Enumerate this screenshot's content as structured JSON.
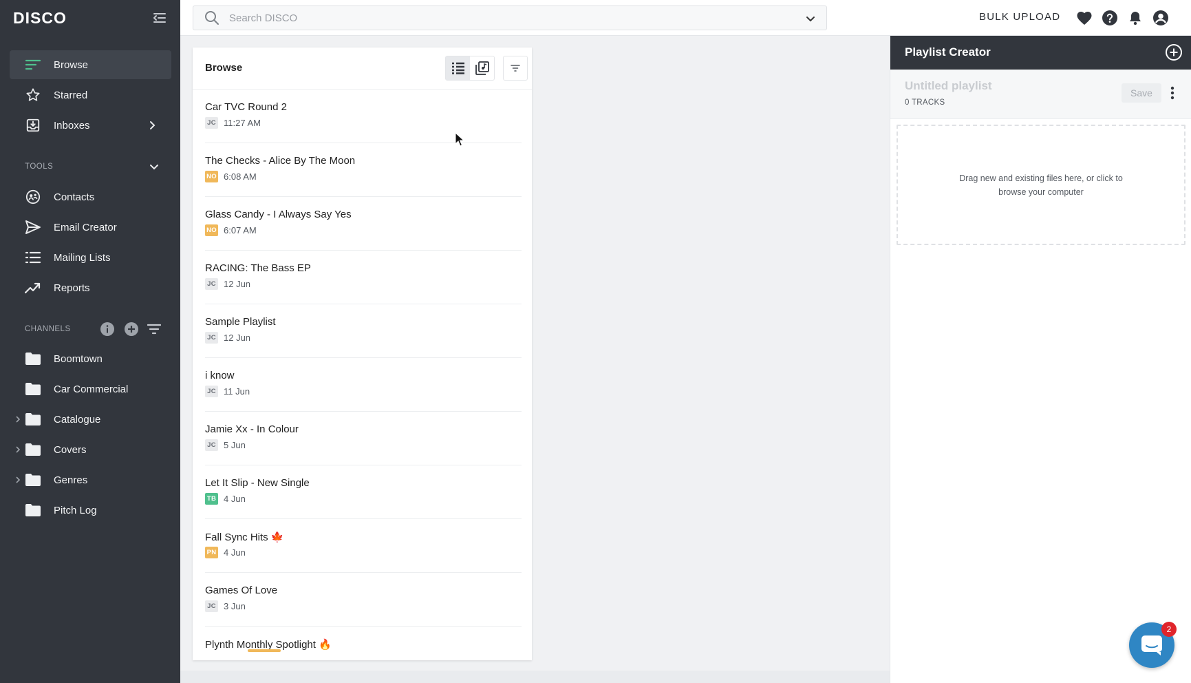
{
  "app": {
    "logo": "DISCO"
  },
  "sidebar": {
    "nav": [
      {
        "label": "Browse",
        "icon": "browse-lines-icon",
        "active": true
      },
      {
        "label": "Starred",
        "icon": "star-icon"
      },
      {
        "label": "Inboxes",
        "icon": "inbox-icon",
        "has_chevron": true
      }
    ],
    "tools_header": "TOOLS",
    "tools": [
      {
        "label": "Contacts",
        "icon": "contacts-icon"
      },
      {
        "label": "Email Creator",
        "icon": "send-icon"
      },
      {
        "label": "Mailing Lists",
        "icon": "list-icon"
      },
      {
        "label": "Reports",
        "icon": "trend-icon"
      }
    ],
    "channels_header": "CHANNELS",
    "channels": [
      {
        "label": "Boomtown",
        "expandable": false
      },
      {
        "label": "Car Commercial",
        "expandable": false
      },
      {
        "label": "Catalogue",
        "expandable": true
      },
      {
        "label": "Covers",
        "expandable": true
      },
      {
        "label": "Genres",
        "expandable": true
      },
      {
        "label": "Pitch Log",
        "expandable": false
      }
    ]
  },
  "topbar": {
    "search_placeholder": "Search DISCO",
    "bulk_upload": "BULK UPLOAD"
  },
  "browse": {
    "title": "Browse",
    "items": [
      {
        "title": "Car TVC Round 2",
        "badge": "JC",
        "badge_color": "#e9eaec",
        "badge_text_color": "#6c7077",
        "date": "11:27 AM"
      },
      {
        "title": "The Checks - Alice By The Moon",
        "badge": "NO",
        "badge_color": "#f0b85a",
        "badge_text_color": "#ffffff",
        "date": "6:08 AM"
      },
      {
        "title": "Glass Candy - I Always Say Yes",
        "badge": "NO",
        "badge_color": "#f0b85a",
        "badge_text_color": "#ffffff",
        "date": "6:07 AM"
      },
      {
        "title": "RACING: The Bass EP",
        "badge": "JC",
        "badge_color": "#e9eaec",
        "badge_text_color": "#6c7077",
        "date": "12 Jun"
      },
      {
        "title": "Sample Playlist",
        "badge": "JC",
        "badge_color": "#e9eaec",
        "badge_text_color": "#6c7077",
        "date": "12 Jun"
      },
      {
        "title": "i know",
        "badge": "JC",
        "badge_color": "#e9eaec",
        "badge_text_color": "#6c7077",
        "date": "11 Jun"
      },
      {
        "title": "Jamie Xx - In Colour",
        "badge": "JC",
        "badge_color": "#e9eaec",
        "badge_text_color": "#6c7077",
        "date": "5 Jun"
      },
      {
        "title": "Let It Slip - New Single",
        "badge": "TB",
        "badge_color": "#4fc08d",
        "badge_text_color": "#ffffff",
        "date": "4 Jun"
      },
      {
        "title": "Fall Sync Hits 🍁",
        "badge": "PN",
        "badge_color": "#f0b85a",
        "badge_text_color": "#ffffff",
        "date": "4 Jun"
      },
      {
        "title": "Games Of Love",
        "badge": "JC",
        "badge_color": "#e9eaec",
        "badge_text_color": "#6c7077",
        "date": "3 Jun"
      },
      {
        "title": "Plynth Monthly Spotlight 🔥",
        "badge": "",
        "badge_color": "#f0b85a",
        "badge_text_color": "#ffffff",
        "date": ""
      }
    ]
  },
  "playlist_creator": {
    "title": "Playlist Creator",
    "name_placeholder": "Untitled playlist",
    "tracks": "0 TRACKS",
    "save": "Save",
    "dropzone_text": "Drag new and existing files here, or click to browse your computer"
  },
  "chat": {
    "unread": "2"
  }
}
